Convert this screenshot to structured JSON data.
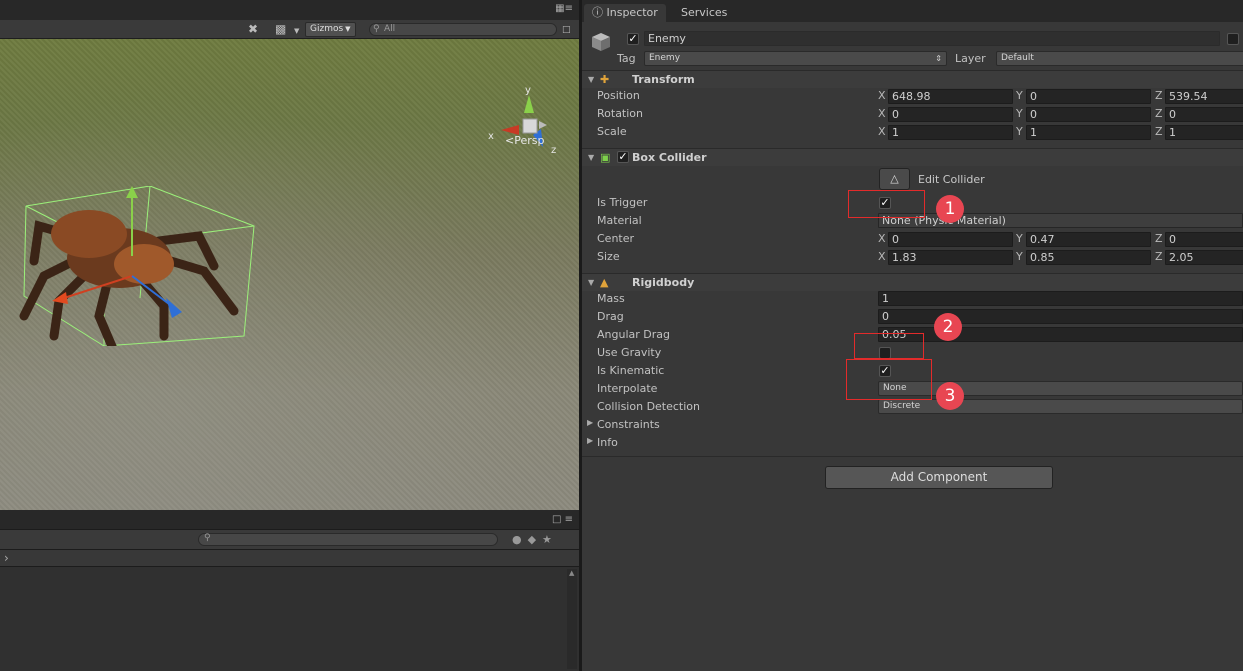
{
  "scene": {
    "toolbar": {
      "gizmos_label": "Gizmos",
      "search_placeholder": "All"
    },
    "view": {
      "projection_label": "Persp",
      "axis_labels": {
        "x": "x",
        "y": "y",
        "z": "z"
      }
    }
  },
  "inspector": {
    "tabs": [
      {
        "label": "Inspector"
      },
      {
        "label": "Services"
      }
    ],
    "object": {
      "active": true,
      "name": "Enemy",
      "tag_label": "Tag",
      "tag_value": "Enemy",
      "layer_label": "Layer",
      "layer_value": "Default"
    },
    "transform": {
      "title": "Transform",
      "rows": [
        {
          "label": "Position",
          "x": "648.98",
          "y": "0",
          "z": "539.54"
        },
        {
          "label": "Rotation",
          "x": "0",
          "y": "0",
          "z": "0"
        },
        {
          "label": "Scale",
          "x": "1",
          "y": "1",
          "z": "1"
        }
      ]
    },
    "box_collider": {
      "title": "Box Collider",
      "enabled": true,
      "edit_collider_label": "Edit Collider",
      "is_trigger_label": "Is Trigger",
      "is_trigger": true,
      "material_label": "Material",
      "material_value": "None (Physic Material)",
      "center": {
        "label": "Center",
        "x": "0",
        "y": "0.47",
        "z": "0"
      },
      "size": {
        "label": "Size",
        "x": "1.83",
        "y": "0.85",
        "z": "2.05"
      }
    },
    "rigidbody": {
      "title": "Rigidbody",
      "mass_label": "Mass",
      "mass": "1",
      "drag_label": "Drag",
      "drag": "0",
      "angular_drag_label": "Angular Drag",
      "angular_drag": "0.05",
      "use_gravity_label": "Use Gravity",
      "use_gravity": false,
      "is_kinematic_label": "Is Kinematic",
      "is_kinematic": true,
      "interpolate_label": "Interpolate",
      "interpolate": "None",
      "collision_label": "Collision Detection",
      "collision": "Discrete",
      "constraints_label": "Constraints",
      "info_label": "Info"
    },
    "add_component_label": "Add Component"
  },
  "annotations": {
    "badge_1": "1",
    "badge_2": "2",
    "badge_3": "3"
  },
  "colors": {
    "callout_border": "#e32b2b",
    "badge_fill": "#e84652",
    "panel_bg": "#383838"
  },
  "icons": [
    "tools-icon",
    "camera-icon",
    "search-icon",
    "lock-icon",
    "menu-icon",
    "cube-icon",
    "transform-icon",
    "box-collider-icon",
    "rigidbody-icon",
    "edit-collider-icon",
    "persp-icon"
  ]
}
